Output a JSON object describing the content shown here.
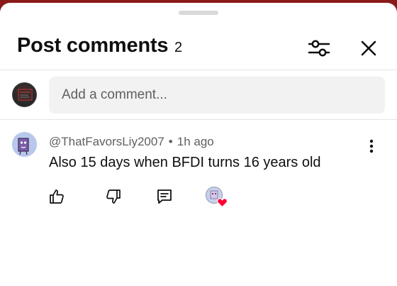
{
  "header": {
    "title": "Post comments",
    "count": "2"
  },
  "composer": {
    "placeholder": "Add a comment..."
  },
  "comments": [
    {
      "author": "@ThatFavorsLiy2007",
      "separator": "•",
      "time": "1h ago",
      "text": "Also 15 days when BFDI turns 16 years old"
    }
  ],
  "icons": {
    "filter": "sliders-icon",
    "close": "close-icon",
    "more": "more-vertical-icon",
    "like": "thumbs-up-icon",
    "dislike": "thumbs-down-icon",
    "reply": "reply-icon",
    "creator_heart": "heart-icon"
  },
  "colors": {
    "background_strip": "#8a1a1a",
    "heart": "#ff0033",
    "input_bg": "#f2f2f2",
    "secondary_text": "#606060"
  }
}
